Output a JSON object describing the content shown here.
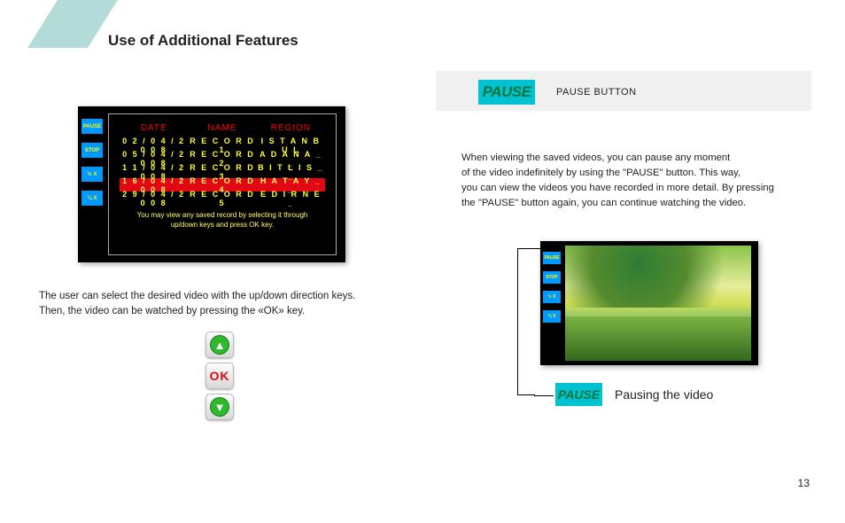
{
  "page": {
    "title": "Use of Additional Features",
    "number": "13"
  },
  "recordPanel": {
    "headers": {
      "date": "DATE",
      "name": "NAME",
      "region": "REGION"
    },
    "rows": [
      {
        "date": "0 2 / 0 4 / 2 0 0 8",
        "name": "R E C O R D 1",
        "region": "I S T A N B U L"
      },
      {
        "date": "0 5 / 0 4 / 2 0 0 8",
        "name": "R E C O R D 2",
        "region": "A D A N A _ _"
      },
      {
        "date": "1 1 / 0 4 / 2 0 0 8",
        "name": "R E C O R D 3",
        "region": "B I T L I S _ _"
      },
      {
        "date": "1 6 / 0 4 / 2 0 0 8",
        "name": "R E C O R D 4",
        "region": "H A T A Y _ _"
      },
      {
        "date": "2 9 / 0 4 / 2 0 0 8",
        "name": "R E C O R D 5",
        "region": "E D I R N E _"
      }
    ],
    "help": "You may view any saved record by selecting it through up/down keys and press OK key.",
    "sideButtons": [
      "PAUSE",
      "STOP",
      "½ X",
      "¼ X"
    ]
  },
  "leftCaption": {
    "line1": "The user can select the desired video with the up/down direction keys.",
    "line2": "Then, the video can be watched by pressing the «OK» key."
  },
  "remote": {
    "ok": "OK"
  },
  "pauseSection": {
    "badge": "PAUSE",
    "label": "PAUSE BUTTON",
    "descLine1": "When viewing the saved videos, you can pause any moment",
    "descLine2": "of the video indefinitely by using the \"PAUSE\" button. This way,",
    "descLine3": "you can view the videos you have recorded in more detail. By pressing",
    "descLine4": "the \"PAUSE\" button again, you can continue watching the video.",
    "pauseBadge2": "PAUSE",
    "pausingText": "Pausing the video"
  }
}
